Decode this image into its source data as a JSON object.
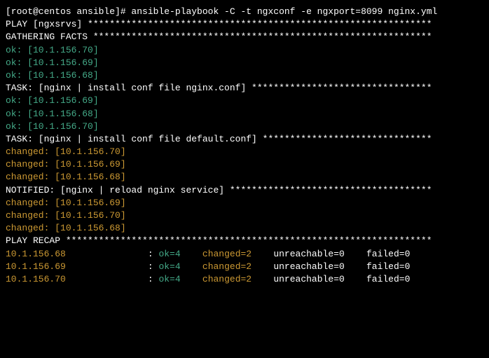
{
  "prompt": "[root@centos ansible]# ansible-playbook -C -t ngxconf -e ngxport=8099 nginx.yml",
  "blank": "",
  "play_header": "PLAY [ngxsrvs] ***************************************************************",
  "gathering_header": "GATHERING FACTS **************************************************************",
  "gathering": [
    "ok: [10.1.156.70]",
    "ok: [10.1.156.69]",
    "ok: [10.1.156.68]"
  ],
  "task1_header": "TASK: [nginx | install conf file nginx.conf] *********************************",
  "task1": [
    "ok: [10.1.156.69]",
    "ok: [10.1.156.68]",
    "ok: [10.1.156.70]"
  ],
  "task2_header": "TASK: [nginx | install conf file default.conf] *******************************",
  "task2": [
    "changed: [10.1.156.70]",
    "changed: [10.1.156.69]",
    "changed: [10.1.156.68]"
  ],
  "notified_header": "NOTIFIED: [nginx | reload nginx service] *************************************",
  "notified": [
    "changed: [10.1.156.69]",
    "changed: [10.1.156.70]",
    "changed: [10.1.156.68]"
  ],
  "recap_header": "PLAY RECAP *******************************************************************",
  "recap": [
    {
      "host": "10.1.156.68",
      "ok": "ok=4",
      "changed": "changed=2",
      "unreachable": "unreachable=0",
      "failed": "failed=0"
    },
    {
      "host": "10.1.156.69",
      "ok": "ok=4",
      "changed": "changed=2",
      "unreachable": "unreachable=0",
      "failed": "failed=0"
    },
    {
      "host": "10.1.156.70",
      "ok": "ok=4",
      "changed": "changed=2",
      "unreachable": "unreachable=0",
      "failed": "failed=0"
    }
  ]
}
